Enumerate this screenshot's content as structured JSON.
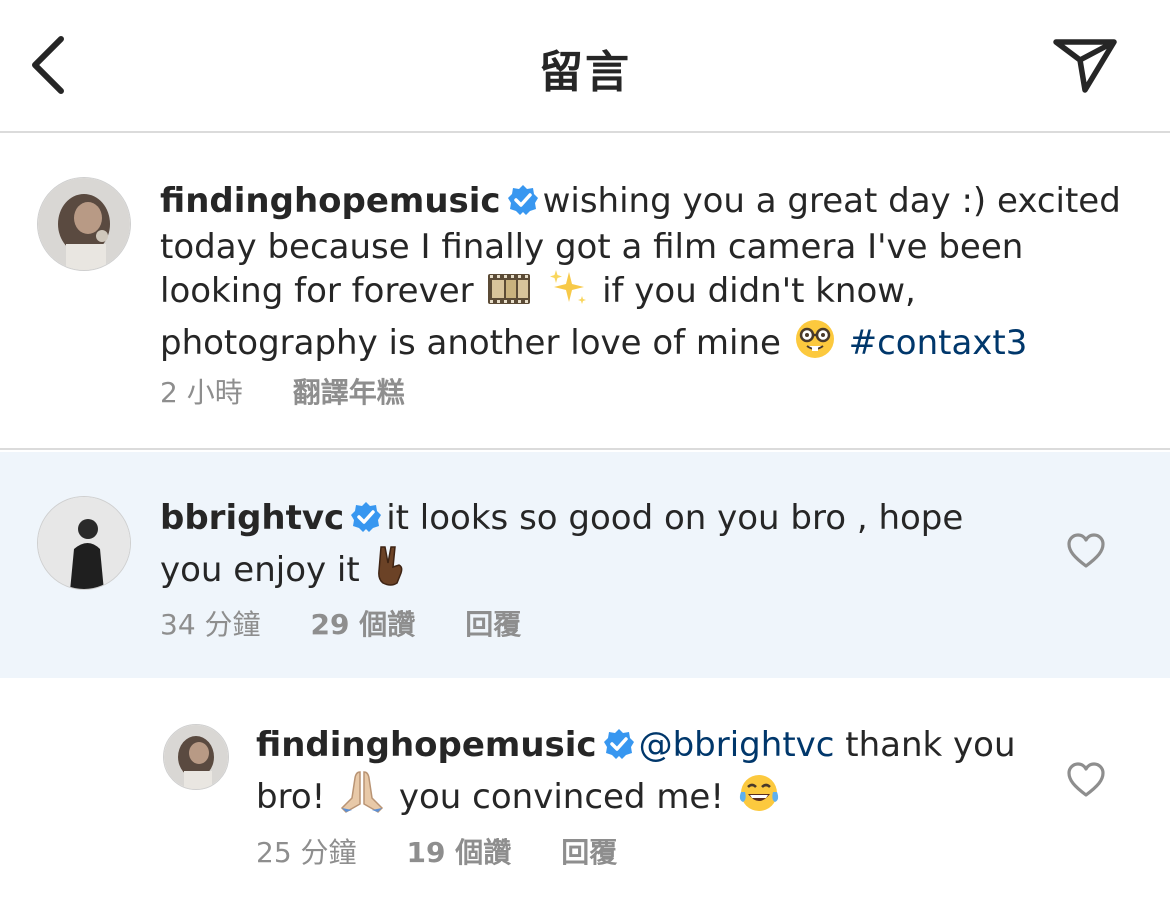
{
  "header": {
    "title": "留言"
  },
  "caption": {
    "username": "findinghopemusic",
    "text_line1": "wishing you a great day :) excited",
    "text_line2": "today because I finally got a film camera I've been",
    "text_line3a": "looking for forever",
    "text_line3b": "if you didn't know,",
    "text_line4": "photography is another love of mine",
    "hashtag": "#contaxt3",
    "time": "2 小時",
    "translate": "翻譯年糕"
  },
  "comments": [
    {
      "username": "bbrightvc",
      "text_line1": "it looks so good on you bro , hope",
      "text_line2": "you enjoy it",
      "time": "34 分鐘",
      "likes": "29 個讚",
      "reply": "回覆"
    },
    {
      "username": "findinghopemusic",
      "mention": "@bbrightvc",
      "text_line1": "thank you",
      "text_line2a": "bro!",
      "text_line2b": "you convinced me!",
      "time": "25 分鐘",
      "likes": "19 個讚",
      "reply": "回覆"
    }
  ],
  "icons": [
    "back-arrow-icon",
    "send-icon",
    "verified-badge-icon",
    "heart-icon"
  ],
  "colors": {
    "hashtag": "#00376b",
    "verified": "#3897f0",
    "highlight_row": "#eff5fb",
    "meta": "#8e8e8e"
  }
}
